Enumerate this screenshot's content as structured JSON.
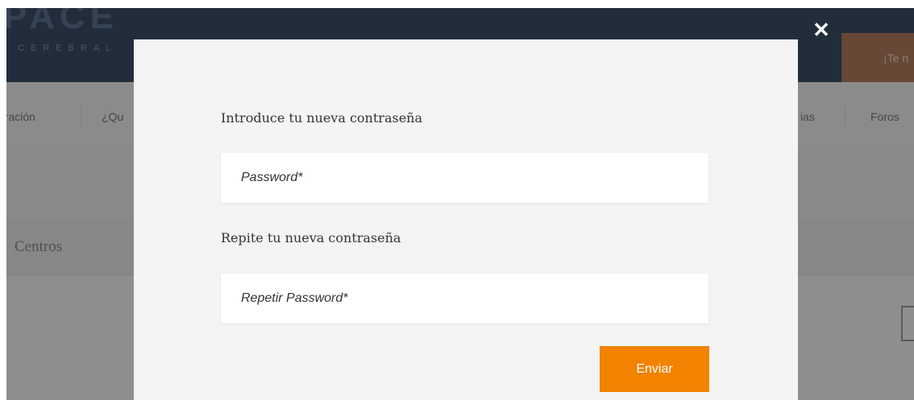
{
  "background": {
    "logo": "PACE",
    "logo_subtitle": "CEREBRAL",
    "cta_label": "¡Te n",
    "nav_items": [
      "eración",
      "¿Qu",
      "ias",
      "Foros"
    ],
    "section_title": "Centros"
  },
  "modal": {
    "close_symbol": "✕",
    "new_password_label": "Introduce tu nueva contraseña",
    "password_placeholder": "Password*",
    "repeat_label": "Repite tu nueva contraseña",
    "repeat_placeholder": "Repetir Password*",
    "submit_label": "Enviar"
  },
  "colors": {
    "header": "#3b4f66",
    "accent": "#f28200",
    "modal_bg": "#f4f4f4"
  }
}
